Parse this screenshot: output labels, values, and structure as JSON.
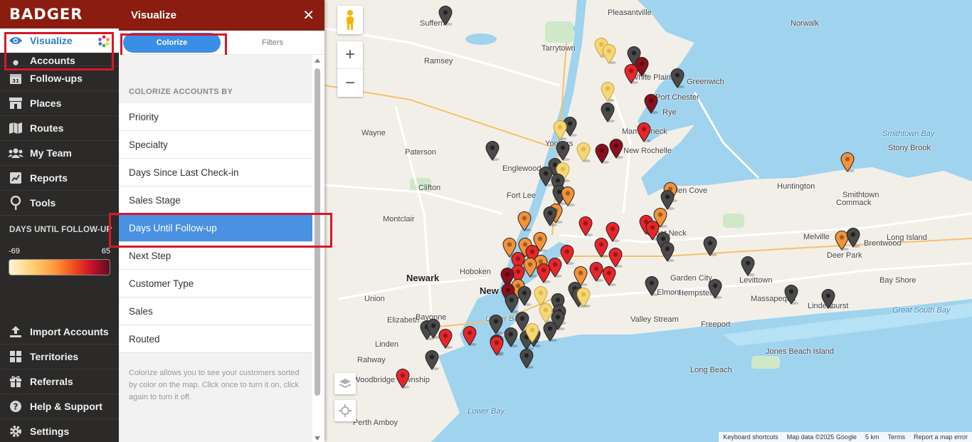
{
  "nav": {
    "logo": "BADGER",
    "items": [
      {
        "label": "Visualize",
        "icon": "eye-icon",
        "active": true
      },
      {
        "label": "Accounts",
        "icon": "person-icon"
      },
      {
        "label": "Follow-ups",
        "icon": "calendar-icon"
      },
      {
        "label": "Places",
        "icon": "store-icon"
      },
      {
        "label": "Routes",
        "icon": "map-icon"
      },
      {
        "label": "My Team",
        "icon": "team-icon"
      },
      {
        "label": "Reports",
        "icon": "chart-icon"
      },
      {
        "label": "Tools",
        "icon": "pin-tool-icon"
      }
    ],
    "legend": {
      "title": "DAYS UNTIL FOLLOW-UP",
      "min": "-69",
      "max": "65"
    },
    "bottom_items": [
      {
        "label": "Import Accounts",
        "icon": "upload-icon"
      },
      {
        "label": "Territories",
        "icon": "grid-icon"
      },
      {
        "label": "Referrals",
        "icon": "gift-icon"
      },
      {
        "label": "Help & Support",
        "icon": "help-icon"
      },
      {
        "label": "Settings",
        "icon": "gear-icon"
      }
    ]
  },
  "panel": {
    "title": "Visualize",
    "close": "✕",
    "tabs": {
      "colorize": "Colorize",
      "filters": "Filters"
    },
    "section_title": "COLORIZE ACCOUNTS BY",
    "options": [
      "Priority",
      "Specialty",
      "Days Since Last Check-in",
      "Sales Stage",
      "Days Until Follow-up",
      "Next Step",
      "Customer Type",
      "Sales",
      "Routed"
    ],
    "selected_option": "Days Until Follow-up",
    "help_text": "Colorize allows you to see your customers sorted by color on the map. Click once to turn it on, click again to turn it off."
  },
  "map": {
    "zoom_in": "+",
    "zoom_out": "−",
    "labels": [
      "Pleasantville",
      "White Plains",
      "Greenwich",
      "Norwalk",
      "Port Chester",
      "Rye",
      "Suffern",
      "Ramsey",
      "Tarrytown",
      "Wayne",
      "Paterson",
      "Yonkers",
      "Englewood",
      "Fort Lee",
      "Clifton",
      "Montclair",
      "Newark",
      "Hoboken",
      "New York",
      "Union",
      "Elizabeth",
      "Bayonne",
      "Linden",
      "Rahway",
      "Woodbridge Township",
      "Perth Amboy",
      "Mamaroneck",
      "New Rochelle",
      "Glen Cove",
      "Great Neck",
      "Huntington",
      "Commack",
      "Smithtown",
      "Stony Brook",
      "Melville",
      "Deer Park",
      "Brentwood",
      "Long Island",
      "Garden City",
      "Levittown",
      "Hempstead",
      "Elmont",
      "Valley Stream",
      "Freeport",
      "Massapequa",
      "Lindenhurst",
      "Bay Shore",
      "Long Beach",
      "Jones Beach Island",
      "Great South Bay",
      "Smithtown Bay",
      "Lower Bay",
      "Upper Bay"
    ],
    "attribution": [
      "Keyboard shortcuts",
      "Map data ©2025 Google",
      "5 km",
      "Terms",
      "Report a map error"
    ],
    "pin_colors": {
      "gray": "#4a4a4a",
      "pale": "#f5d77a",
      "orange": "#f4923a",
      "red": "#e8262a",
      "dark": "#8b0f1f"
    }
  }
}
